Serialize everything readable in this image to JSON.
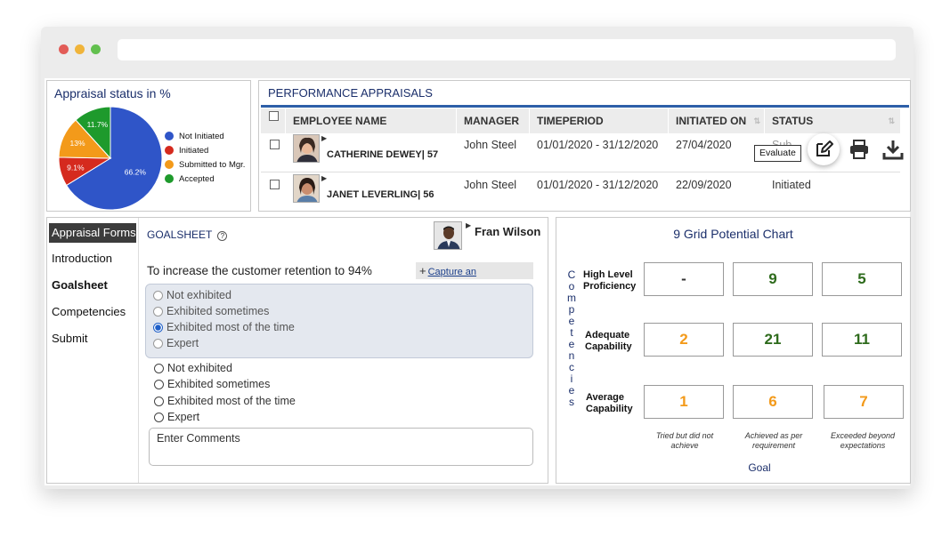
{
  "pie": {
    "title": "Appraisal status in %",
    "slices": [
      {
        "label": "Not Initiated",
        "value": 66.2,
        "text": "66.2%",
        "color": "#2f55c8"
      },
      {
        "label": "Initiated",
        "value": 9.1,
        "text": "9.1%",
        "color": "#d52a1e"
      },
      {
        "label": "Submitted to Mgr.",
        "value": 13,
        "text": "13%",
        "color": "#f39a1a"
      },
      {
        "label": "Accepted",
        "value": 11.7,
        "text": "11.7%",
        "color": "#1e9a2c"
      }
    ]
  },
  "perf": {
    "title": "PERFORMANCE APPRAISALS",
    "columns": [
      "EMPLOYEE NAME",
      "MANAGER",
      "TIMEPERIOD",
      "INITIATED ON",
      "STATUS"
    ],
    "rows": [
      {
        "employee": "CATHERINE DEWEY| 57",
        "manager": "John Steel",
        "period": "01/01/2020 - 31/12/2020",
        "initiated": "27/04/2020",
        "status": "Sub..."
      },
      {
        "employee": "JANET LEVERLING| 56",
        "manager": "John Steel",
        "period": "01/01/2020 - 31/12/2020",
        "initiated": "22/09/2020",
        "status": "Initiated"
      }
    ],
    "evaluate_tooltip": "Evaluate"
  },
  "forms": {
    "header": "Appraisal Forms",
    "items": [
      "Introduction",
      "Goalsheet",
      "Competencies",
      "Submit"
    ],
    "section": "GOALSHEET",
    "help": "?",
    "employee": "Fran Wilson",
    "question": "To increase the customer retention to 94%",
    "capture": "Capture an achievement",
    "capture_plus": "+",
    "options": [
      "Not exhibited",
      "Exhibited sometimes",
      "Exhibited most of the time",
      "Expert"
    ],
    "comments_placeholder": "Enter Comments"
  },
  "grid": {
    "title": "9 Grid Potential Chart",
    "vertical_label": [
      "C",
      "o",
      "m",
      "p",
      "e",
      "t",
      "e",
      "n",
      "c",
      "i",
      "e",
      "s"
    ],
    "rows": [
      "High Level Proficiency",
      "Adequate Capability",
      "Average Capability"
    ],
    "cols": [
      "Tried but did not achieve",
      "Achieved as per requirement",
      "Exceeded beyond expectations"
    ],
    "cells": [
      [
        "-",
        "9",
        "5"
      ],
      [
        "2",
        "21",
        "11"
      ],
      [
        "1",
        "6",
        "7"
      ]
    ],
    "goal_label": "Goal",
    "colors": {
      "green": "#2e6b1c",
      "orange": "#f39a1a"
    }
  }
}
